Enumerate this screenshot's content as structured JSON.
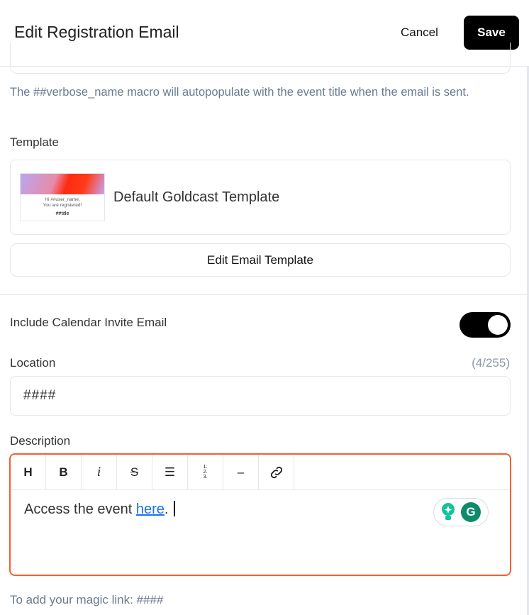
{
  "header": {
    "title": "Edit Registration Email",
    "cancel_label": "Cancel",
    "save_label": "Save"
  },
  "subject_help": "The ##verbose_name macro will autopopulate with the event title when the email is sent.",
  "template": {
    "label": "Template",
    "name": "Default Goldcast Template",
    "thumbnail_line1": "Hi ##user_name,",
    "thumbnail_line2": "You are registered!",
    "thumbnail_title": "##title",
    "edit_label": "Edit Email Template"
  },
  "calendar": {
    "label": "Include Calendar Invite Email",
    "enabled": true
  },
  "location": {
    "label": "Location",
    "counter": "(4/255)",
    "value": "####"
  },
  "description": {
    "label": "Description",
    "toolbar": [
      "H",
      "B",
      "i",
      "S",
      "bullet-list",
      "ordered-list",
      "horizontal-rule",
      "link"
    ],
    "text_before": "Access the event ",
    "link_text": "here",
    "text_after": ".",
    "accent_color": "#f26131"
  },
  "footer": {
    "magic_link_hint": "To add your magic link: ####"
  }
}
